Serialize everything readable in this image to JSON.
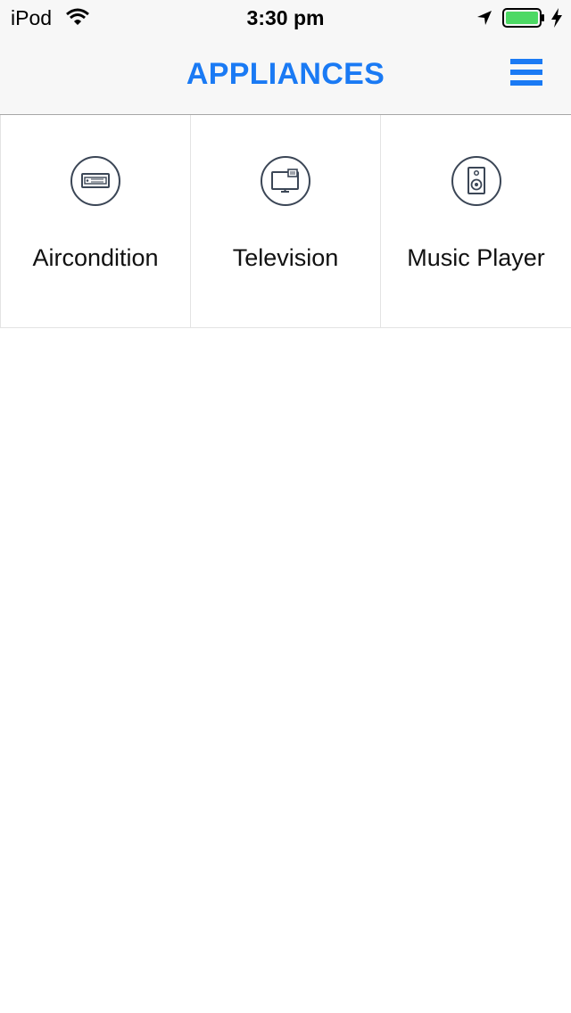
{
  "status_bar": {
    "carrier": "iPod",
    "time": "3:30 pm",
    "icons": [
      "wifi-icon",
      "location-arrow-icon",
      "battery-icon",
      "charging-bolt-icon"
    ],
    "battery_color": "#4cd964"
  },
  "nav": {
    "title": "APPLIANCES",
    "menu_icon": "hamburger-menu-icon",
    "accent_color": "#1a7af4"
  },
  "appliances": [
    {
      "label": "Aircondition",
      "icon": "air-conditioner-icon"
    },
    {
      "label": "Television",
      "icon": "television-icon"
    },
    {
      "label": "Music Player",
      "icon": "speaker-icon"
    }
  ]
}
